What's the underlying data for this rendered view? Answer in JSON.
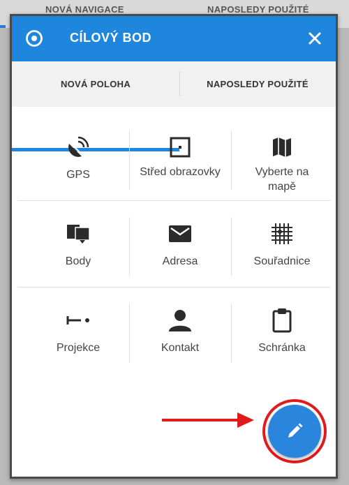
{
  "background": {
    "tabs": [
      "NOVÁ NAVIGACE",
      "NAPOSLEDY POUŽITÉ"
    ]
  },
  "dialog": {
    "title": "CÍLOVÝ BOD",
    "header_color": "#1f86de",
    "icons": {
      "header": "target-icon",
      "close": "close-icon"
    },
    "tabs": [
      {
        "label": "NOVÁ POLOHA",
        "active": true
      },
      {
        "label": "NAPOSLEDY POUŽITÉ",
        "active": false
      }
    ],
    "options": [
      {
        "label": "GPS",
        "icon": "gps-satellite-icon"
      },
      {
        "label": "Střed obrazovky",
        "icon": "screen-center-icon"
      },
      {
        "label": "Vyberte na mapě",
        "icon": "map-icon"
      },
      {
        "label": "Body",
        "icon": "points-icon"
      },
      {
        "label": "Adresa",
        "icon": "envelope-icon"
      },
      {
        "label": "Souřadnice",
        "icon": "coordinates-grid-icon"
      },
      {
        "label": "Projekce",
        "icon": "projection-icon"
      },
      {
        "label": "Kontakt",
        "icon": "contact-icon"
      },
      {
        "label": "Schránka",
        "icon": "clipboard-icon"
      }
    ],
    "fab": {
      "icon": "pencil-icon",
      "highlight_color": "#e01b1b"
    }
  }
}
